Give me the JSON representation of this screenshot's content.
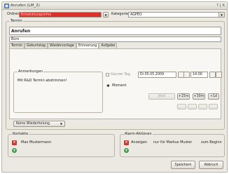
{
  "window": {
    "title": "Anrufen (LM_2)",
    "controls": "? | X"
  },
  "top": {
    "ordner_label": "Ordner",
    "ordner_value": "Entwicklungsinfos",
    "kategorie_label": "Kategorie",
    "kategorie_value": "AGPEO"
  },
  "termin": {
    "group_label": "Termin",
    "subject": "Anrufen",
    "location": "Büro",
    "tabs": [
      "Termin",
      "Geburtstag",
      "Wiedervorlage",
      "Erinnerung",
      "Aufgabe"
    ],
    "active_tab_index": 3
  },
  "notes": {
    "group_label": "Anmerkungen",
    "text": "Mit R&D Termin abstimmen!"
  },
  "schedule": {
    "ganzer_tag_label": "Ganzer Tag",
    "date": "Di 05.05.2009",
    "time": "14:00",
    "moment_label": "Moment",
    "offset_buttons": [
      "Jetzt",
      "+15m",
      "+30m",
      "+1d"
    ],
    "small_buttons": [
      "",
      "",
      "",
      ""
    ]
  },
  "repeat": {
    "label": "Keine Wiederholung"
  },
  "contacts": {
    "group_label": "Kontakte",
    "name": "Max Mustermann"
  },
  "alarms": {
    "group_label": "Alarm-Aktionen",
    "action": "Anzeigen",
    "scope": "nur für Markus Muster",
    "timing": "zum Beginn"
  },
  "footer": {
    "save": "Speichern",
    "cancel": "Abbruch"
  },
  "colors": {
    "folder_field": "#d9302b",
    "dialog_bg": "#ece9e2"
  }
}
